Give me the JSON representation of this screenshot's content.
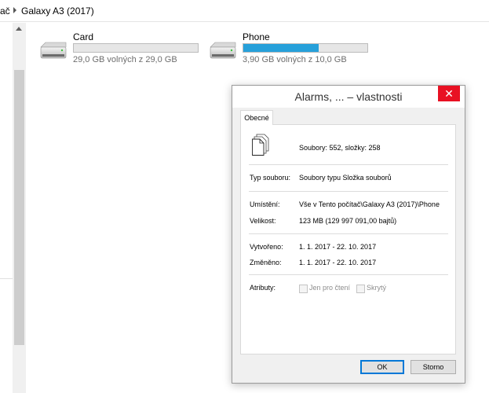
{
  "address": {
    "prev_segment": "ač",
    "current_segment": "Galaxy A3 (2017)"
  },
  "drives": [
    {
      "name": "Card",
      "info": "29,0 GB volných z 29,0 GB",
      "used_fraction": 0.0
    },
    {
      "name": "Phone",
      "info": "3,90 GB volných z 10,0 GB",
      "used_fraction": 0.61
    }
  ],
  "dialog": {
    "title": "Alarms, ... – vlastnosti",
    "close_glyph": "✕",
    "tab": "Obecné",
    "summary": "Soubory: 552, složky: 258",
    "type_label": "Typ souboru:",
    "type_value": "Soubory typu Složka souborů",
    "location_label": "Umístění:",
    "location_value": "Vše v Tento počítač\\Galaxy A3 (2017)\\Phone",
    "size_label": "Velikost:",
    "size_value": "123 MB (129 997 091,00 bajtů)",
    "created_label": "Vytvořeno:",
    "created_value": "1. 1. 2017 - 22. 10. 2017",
    "modified_label": "Změněno:",
    "modified_value": "1. 1. 2017 - 22. 10. 2017",
    "attributes_label": "Atributy:",
    "readonly_label": "Jen pro čtení",
    "hidden_label": "Skrytý",
    "ok_label": "OK",
    "cancel_label": "Storno"
  },
  "icons": {
    "address_separator": "chevron-right-icon",
    "drive": "drive-icon",
    "file": "multiple-files-icon",
    "scroll_up": "scroll-up-arrow-icon"
  },
  "colors": {
    "accent": "#26a0da",
    "close": "#e81123",
    "ok_border": "#0078d7"
  }
}
